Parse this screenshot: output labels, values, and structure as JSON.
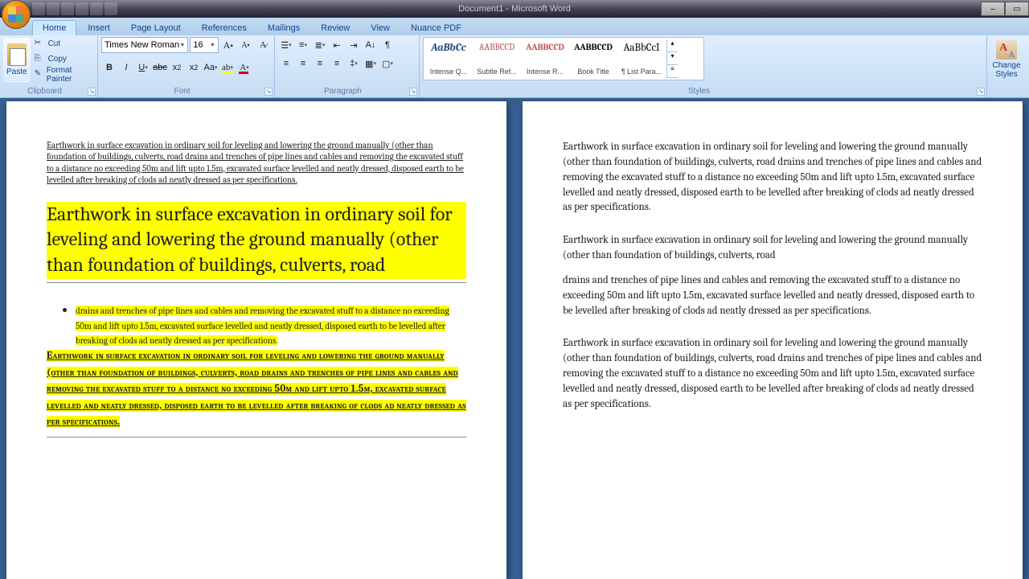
{
  "title": "Document1 - Microsoft Word",
  "tabs": [
    "Home",
    "Insert",
    "Page Layout",
    "References",
    "Mailings",
    "Review",
    "View",
    "Nuance PDF"
  ],
  "activeTab": "Home",
  "clipboard": {
    "paste": "Paste",
    "cut": "Cut",
    "copy": "Copy",
    "formatPainter": "Format Painter",
    "label": "Clipboard"
  },
  "font": {
    "name": "Times New Roman",
    "size": "16",
    "label": "Font"
  },
  "paragraph": {
    "label": "Paragraph"
  },
  "styles": {
    "label": "Styles",
    "items": [
      {
        "preview": "AaBbCc",
        "name": "Intense Q...",
        "color": "#1f497d",
        "italic": true,
        "bold": true
      },
      {
        "preview": "AABBCCD",
        "name": "Subtle Ref...",
        "color": "#c0504d",
        "smallcaps": true
      },
      {
        "preview": "AABBCCD",
        "name": "Intense R...",
        "color": "#c0504d",
        "smallcaps": true,
        "bold": true
      },
      {
        "preview": "AABBCCD",
        "name": "Book Title",
        "color": "#000",
        "smallcaps": true,
        "bold": true
      },
      {
        "preview": "AaBbCcI",
        "name": "¶ List Para...",
        "color": "#000"
      }
    ],
    "changeStyles": "Change Styles"
  },
  "page1": {
    "block1": "Earthwork in surface excavation in ordinary soil for leveling and lowering the ground manually (other than foundation of buildings, culverts, road drains and trenches of pipe lines and cables and removing the excavated stuff to a distance no exceeding 50m and lift upto 1.5m, excavated surface levelled and neatly dressed, disposed earth to be levelled after breaking of clods ad neatly dressed as per specifications.",
    "heading": "Earthwork in surface excavation in ordinary soil for leveling and lowering the ground manually (other than foundation of buildings, culverts, road",
    "bullet": "drains and trenches of pipe lines and cables and removing the excavated stuff to a distance no exceeding 50m and lift upto 1.5m, excavated surface levelled and neatly dressed, disposed earth to be levelled after breaking of clods ad neatly dressed as per specifications.",
    "block3": "Earthwork in surface excavation in ordinary soil for leveling and lowering the ground manually (other than foundation of buildings, culverts, road drains and trenches of pipe lines and cables and removing the excavated stuff to a distance no exceeding 50m and lift upto 1.5m, excavated surface levelled and neatly dressed, disposed earth to be levelled after breaking of clods ad neatly dressed as per specifications."
  },
  "page2": {
    "block1": "Earthwork in surface excavation in ordinary soil for leveling and lowering the ground manually (other than foundation of buildings, culverts, road drains and trenches of pipe lines and cables and removing the excavated stuff to a distance no exceeding 50m and lift upto 1.5m, excavated surface levelled and neatly dressed, disposed earth to be levelled after breaking of clods ad neatly dressed as per specifications.",
    "block2": "Earthwork in surface excavation in ordinary soil for leveling and lowering the ground manually (other than foundation of buildings, culverts, road",
    "block3": "drains and trenches of pipe lines and cables and removing the excavated stuff to a distance no exceeding 50m and lift upto 1.5m, excavated surface levelled and neatly dressed, disposed earth to be levelled after breaking of clods ad neatly dressed as per specifications.",
    "block4": "Earthwork in surface excavation in ordinary soil for leveling and lowering the ground manually (other than foundation of buildings, culverts, road drains and trenches of pipe lines and cables and removing the excavated stuff to a distance no exceeding 50m and lift upto 1.5m, excavated surface levelled and neatly dressed, disposed earth to be levelled after breaking of clods ad neatly dressed as per specifications."
  }
}
